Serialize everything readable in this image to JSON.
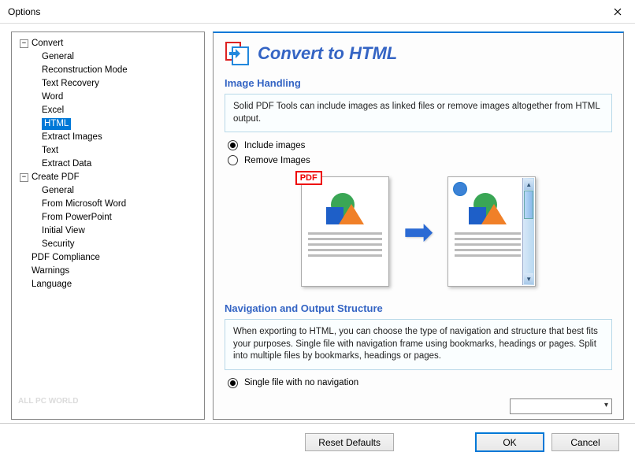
{
  "window": {
    "title": "Options"
  },
  "tree": {
    "convert": {
      "label": "Convert",
      "children": {
        "general": "General",
        "reconstruction": "Reconstruction Mode",
        "textrecovery": "Text Recovery",
        "word": "Word",
        "excel": "Excel",
        "html": "HTML",
        "extractimages": "Extract Images",
        "text": "Text",
        "extractdata": "Extract Data"
      }
    },
    "createpdf": {
      "label": "Create PDF",
      "children": {
        "general": "General",
        "msword": "From Microsoft Word",
        "powerpoint": "From PowerPoint",
        "initialview": "Initial View",
        "security": "Security"
      }
    },
    "pdfcompliance": "PDF Compliance",
    "warnings": "Warnings",
    "language": "Language"
  },
  "panel": {
    "title": "Convert to HTML",
    "section1": {
      "title": "Image Handling",
      "desc": "Solid PDF Tools can include images as linked files or remove images altogether from HTML output.",
      "radio1": "Include images",
      "radio2": "Remove Images"
    },
    "section2": {
      "title": "Navigation and Output Structure",
      "desc": "When exporting to HTML, you can choose the type of navigation and structure that best fits your purposes. Single file with navigation frame using bookmarks, headings or pages. Split into multiple files by bookmarks, headings or pages.",
      "radio1": "Single file with no navigation"
    },
    "pdf_badge": "PDF"
  },
  "buttons": {
    "reset": "Reset Defaults",
    "ok": "OK",
    "cancel": "Cancel"
  },
  "watermark": {
    "line1": "ALL PC WORLD"
  }
}
